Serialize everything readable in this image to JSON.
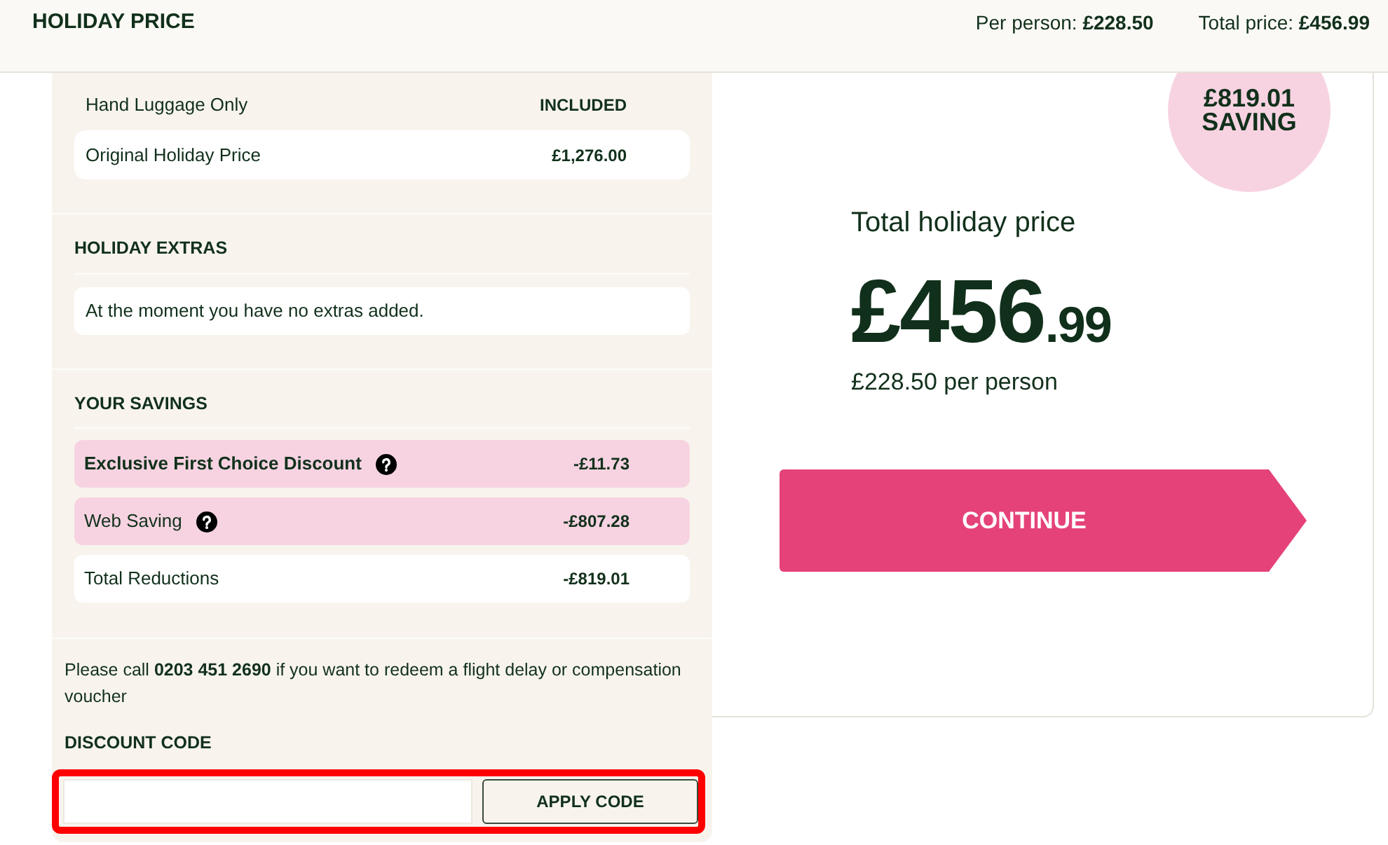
{
  "header": {
    "title": "HOLIDAY PRICE",
    "per_person": "Per person: **£228.50**",
    "total": "Total price: **£456.99**"
  },
  "breakdown": {
    "rows": [
      {
        "label": "Hand Luggage Only",
        "value": "INCLUDED",
        "kind": "plain"
      },
      {
        "label": "Original Holiday Price",
        "value": "£1,276.00",
        "kind": "card"
      }
    ]
  },
  "extras": {
    "title": "HOLIDAY EXTRAS",
    "message": "At the moment you have no extras added."
  },
  "savings": {
    "title": "YOUR SAVINGS",
    "rows": [
      {
        "label": "Exclusive First Choice Discount",
        "value": "-£11.73",
        "kind": "discount",
        "emphasized": true,
        "help": true
      },
      {
        "label": "Web Saving",
        "value": "-£807.28",
        "kind": "discount",
        "emphasized": false,
        "help": true
      },
      {
        "label": "Total Reductions",
        "value": "-£819.01",
        "kind": "total",
        "emphasized": false,
        "help": false
      }
    ]
  },
  "voucher_note": "Please call **0203 451 2690** if you want to redeem a flight delay or compensation voucher",
  "discount": {
    "title": "DISCOUNT CODE",
    "button": "APPLY CODE",
    "highlighted": true
  },
  "summary": {
    "badge": {
      "amount": "£819.01",
      "label": "SAVING"
    },
    "title": "Total holiday price",
    "price_main": "£456",
    "price_pence": ".99",
    "per_person": "£228.50 per person",
    "button": "CONTINUE"
  }
}
